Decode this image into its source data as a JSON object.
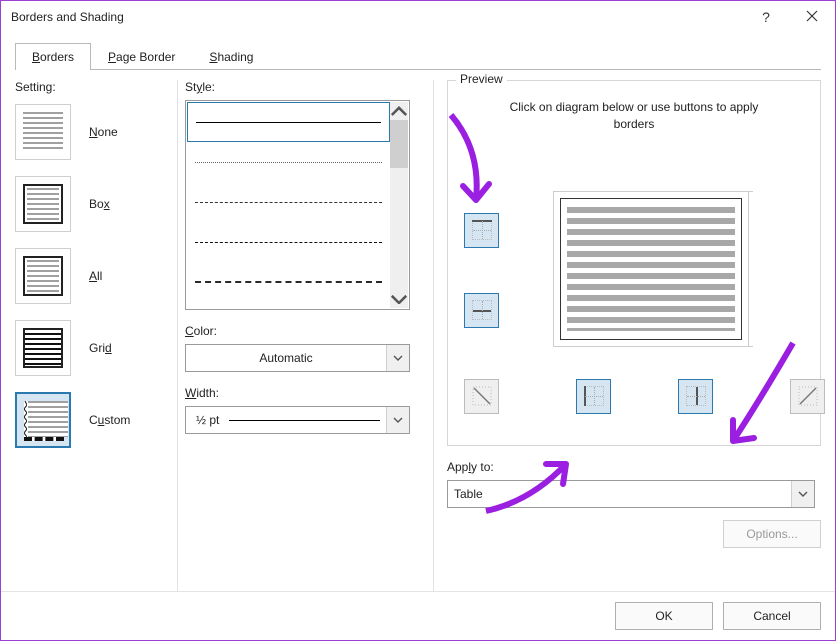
{
  "dialog": {
    "title": "Borders and Shading"
  },
  "tabs": {
    "borders": "Borders",
    "page_border": "Page Border",
    "shading": "Shading"
  },
  "setting": {
    "label": "Setting:",
    "none": "None",
    "box": "Box",
    "all": "All",
    "grid": "Grid",
    "custom": "Custom"
  },
  "style": {
    "label": "Style:"
  },
  "color": {
    "label": "Color:",
    "value": "Automatic"
  },
  "width": {
    "label": "Width:",
    "value": "½ pt"
  },
  "preview": {
    "label": "Preview",
    "caption": "Click on diagram below or use buttons to apply borders"
  },
  "apply_to": {
    "label": "Apply to:",
    "value": "Table"
  },
  "buttons": {
    "options": "Options...",
    "ok": "OK",
    "cancel": "Cancel"
  }
}
